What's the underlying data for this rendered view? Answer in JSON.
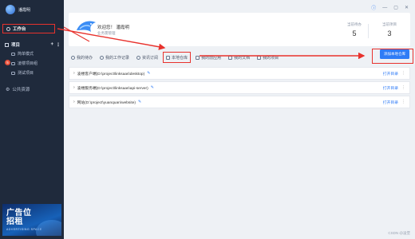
{
  "app": {
    "name": "潘霞明"
  },
  "sidebar": {
    "workbench": "工作台",
    "projects_label": "项目",
    "projects": [
      {
        "label": "简单模式"
      },
      {
        "label": "凌楼项目组",
        "badge": "5"
      },
      {
        "label": "测试项目"
      }
    ],
    "public": "公共资源"
  },
  "ad": {
    "line1": "广告位",
    "line2": "招租",
    "line3": "ADVERTISING SPACE"
  },
  "header": {
    "welcome": "欢迎您！ 潘霞明",
    "subtitle": "业务需管理",
    "stats": [
      {
        "label": "当前待办",
        "value": "5"
      },
      {
        "label": "当前项目",
        "value": "3"
      }
    ]
  },
  "tabs": [
    {
      "label": "我的待办"
    },
    {
      "label": "我的工作记录"
    },
    {
      "label": "资讯订阅"
    },
    {
      "label": "本地仓库",
      "active": true
    },
    {
      "label": "我的前应用"
    },
    {
      "label": "我的文档"
    },
    {
      "label": "我的项目"
    }
  ],
  "add_button": "添加本地仓库",
  "repos": [
    {
      "label": "凌楼客户端(D:\\project\\linksaas\\desktop)",
      "action": "打开目录"
    },
    {
      "label": "凌楼服务端(D:\\project\\linksaas\\api-server)",
      "action": "打开目录"
    },
    {
      "label": "网站(D:\\project\\yuanquan\\website)",
      "action": "打开目录"
    }
  ],
  "footer": "CSDN @凌堡",
  "colors": {
    "accent": "#2f7cf6",
    "annotation": "#e8322d",
    "sidebar": "#1f2a3c"
  }
}
